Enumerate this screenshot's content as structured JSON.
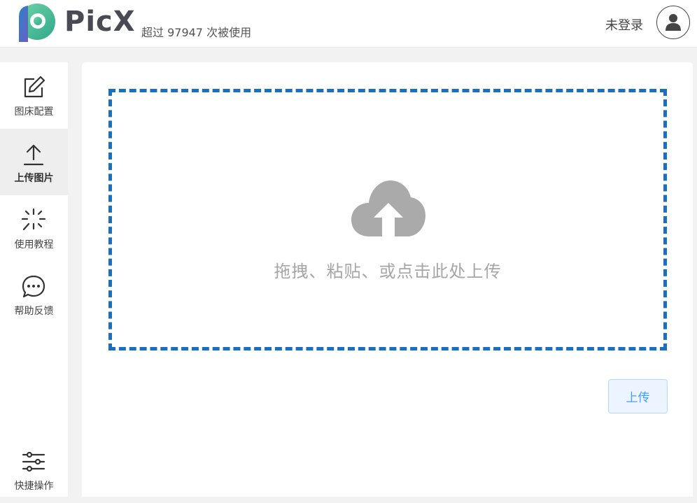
{
  "header": {
    "brand": "PicX",
    "usage_text": "超过 97947 次被使用",
    "login_status": "未登录"
  },
  "sidebar": {
    "items": [
      {
        "label": "图床配置",
        "icon": "edit-icon",
        "active": false
      },
      {
        "label": "上传图片",
        "icon": "upload-icon",
        "active": true
      },
      {
        "label": "使用教程",
        "icon": "sparkle-icon",
        "active": false
      },
      {
        "label": "帮助反馈",
        "icon": "chat-bubble-icon",
        "active": false
      },
      {
        "label": "快捷操作",
        "icon": "sliders-icon",
        "active": false
      }
    ]
  },
  "main": {
    "dropzone_text": "拖拽、粘贴、或点击此处上传",
    "upload_button": "上传"
  },
  "colors": {
    "dropzone_border": "#1a6fbe",
    "cloud": "#aaaaaa",
    "button_bg": "#ecf5ff",
    "button_text": "#409eff",
    "logo_teal": "#3ab795",
    "logo_blue": "#3a7bd5"
  }
}
